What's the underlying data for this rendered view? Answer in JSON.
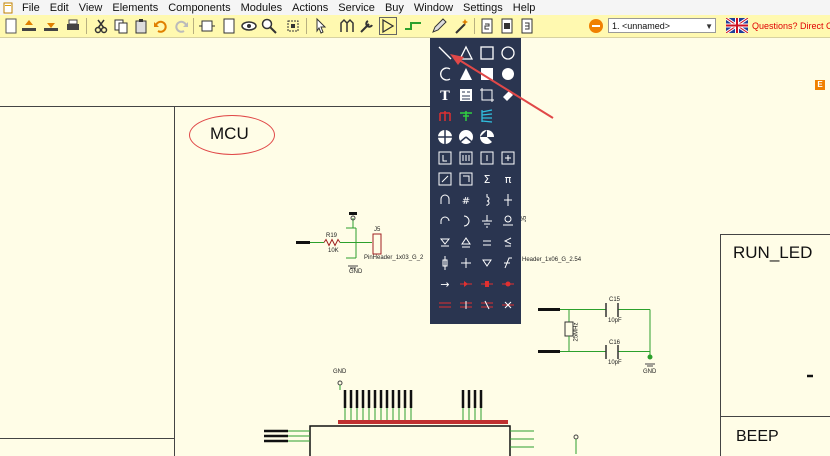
{
  "menu": {
    "items": [
      "File",
      "Edit",
      "View",
      "Elements",
      "Components",
      "Modules",
      "Actions",
      "Service",
      "Buy",
      "Window",
      "Settings",
      "Help"
    ]
  },
  "toolbar": {
    "sheet_select_value": "1. <unnamed>",
    "questions_link": "Questions? Direct Co"
  },
  "canvas": {
    "mcu_label": "MCU",
    "run_led_label": "RUN_LED",
    "beep_label": "BEEP",
    "corner_badge": "E",
    "components": {
      "r19": "R19",
      "r19_value": "10K",
      "j5_left": "J5",
      "pinheader_left": "PinHeader_1x03_G_2",
      "j5_right": "J5",
      "pinheader_right": "Header_1x06_G_2.54",
      "gnd1": "GND",
      "c15": "C15",
      "c15_value": "10pF",
      "c16": "C16",
      "c16_value": "10pF",
      "q1_value": "25MHz",
      "gnd2": "GND",
      "gnd3": "GND"
    }
  },
  "palette": {
    "text_tool_glyph": "T",
    "sigma": "Σ",
    "pi": "π",
    "hash": "#",
    "arrow": "→"
  },
  "colors": {
    "toolbar_bg": "#fff9b0",
    "canvas_bg": "#fffde7",
    "palette_bg": "#2a3550",
    "annotation_red": "#e04848",
    "wire_green": "#2ca02c"
  }
}
